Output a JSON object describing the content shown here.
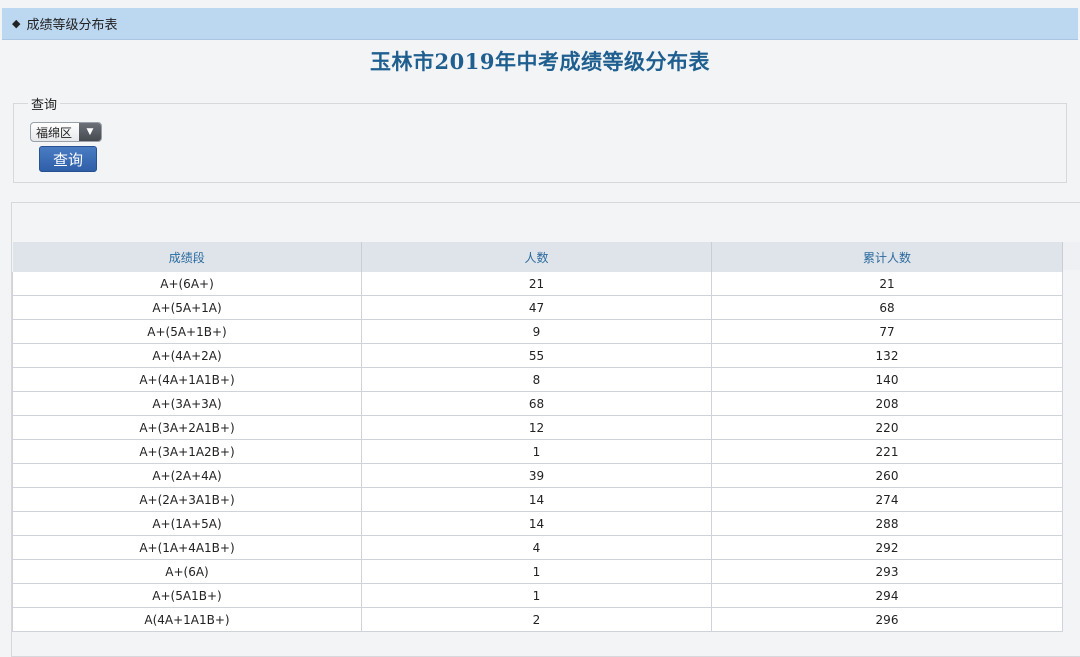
{
  "topbar": {
    "diamond": "◆",
    "title": "成绩等级分布表"
  },
  "page": {
    "title": "玉林市2019年中考成绩等级分布表"
  },
  "query": {
    "legend": "查询",
    "district_selected": "福绵区",
    "dropdown_arrow": "▼",
    "button_label": "查询"
  },
  "table": {
    "headers": [
      "成绩段",
      "人数",
      "累计人数"
    ],
    "rows": [
      [
        "A+(6A+)",
        "21",
        "21"
      ],
      [
        "A+(5A+1A)",
        "47",
        "68"
      ],
      [
        "A+(5A+1B+)",
        "9",
        "77"
      ],
      [
        "A+(4A+2A)",
        "55",
        "132"
      ],
      [
        "A+(4A+1A1B+)",
        "8",
        "140"
      ],
      [
        "A+(3A+3A)",
        "68",
        "208"
      ],
      [
        "A+(3A+2A1B+)",
        "12",
        "220"
      ],
      [
        "A+(3A+1A2B+)",
        "1",
        "221"
      ],
      [
        "A+(2A+4A)",
        "39",
        "260"
      ],
      [
        "A+(2A+3A1B+)",
        "14",
        "274"
      ],
      [
        "A+(1A+5A)",
        "14",
        "288"
      ],
      [
        "A+(1A+4A1B+)",
        "4",
        "292"
      ],
      [
        "A+(6A)",
        "1",
        "293"
      ],
      [
        "A+(5A1B+)",
        "1",
        "294"
      ],
      [
        "A(4A+1A1B+)",
        "2",
        "296"
      ]
    ]
  }
}
